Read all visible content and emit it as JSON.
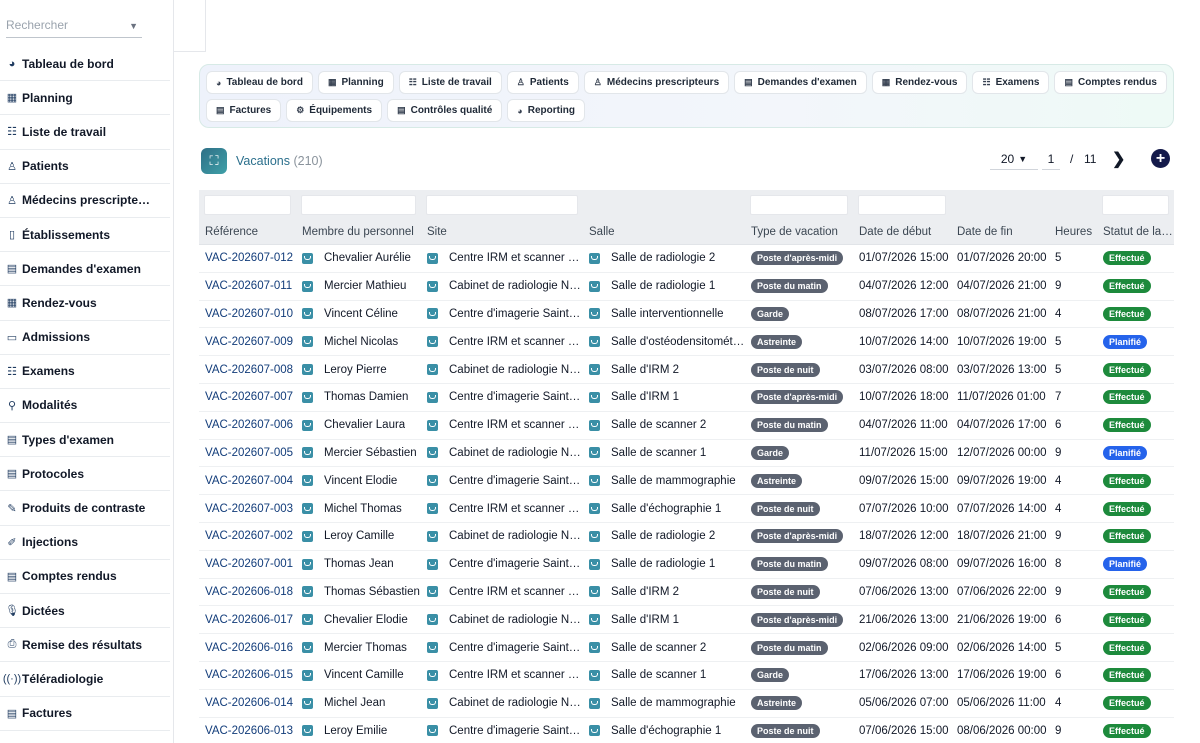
{
  "search": {
    "placeholder": "Rechercher"
  },
  "sidebar": {
    "items": [
      {
        "icon": "dashboard-icon",
        "glyph": "◕",
        "label": "Tableau de bord"
      },
      {
        "icon": "calendar-icon",
        "glyph": "▦",
        "label": "Planning"
      },
      {
        "icon": "worklist-icon",
        "glyph": "☷",
        "label": "Liste de travail"
      },
      {
        "icon": "patients-icon",
        "glyph": "♙",
        "label": "Patients"
      },
      {
        "icon": "doctor-icon",
        "glyph": "♙",
        "label": "Médecins prescripte…"
      },
      {
        "icon": "building-icon",
        "glyph": "▯",
        "label": "Établissements"
      },
      {
        "icon": "request-icon",
        "glyph": "▤",
        "label": "Demandes d'examen"
      },
      {
        "icon": "appointment-icon",
        "glyph": "▦",
        "label": "Rendez-vous"
      },
      {
        "icon": "admission-icon",
        "glyph": "▭",
        "label": "Admissions"
      },
      {
        "icon": "exam-icon",
        "glyph": "☷",
        "label": "Examens"
      },
      {
        "icon": "modality-icon",
        "glyph": "⚲",
        "label": "Modalités"
      },
      {
        "icon": "exam-type-icon",
        "glyph": "▤",
        "label": "Types d'examen"
      },
      {
        "icon": "protocol-icon",
        "glyph": "▤",
        "label": "Protocoles"
      },
      {
        "icon": "contrast-icon",
        "glyph": "✎",
        "label": "Produits de contraste"
      },
      {
        "icon": "syringe-icon",
        "glyph": "✐",
        "label": "Injections"
      },
      {
        "icon": "report-icon",
        "glyph": "▤",
        "label": "Comptes rendus"
      },
      {
        "icon": "microphone-icon",
        "glyph": "🎙",
        "label": "Dictées"
      },
      {
        "icon": "printer-icon",
        "glyph": "⎙",
        "label": "Remise des résultats"
      },
      {
        "icon": "teleradiology-icon",
        "glyph": "((·))",
        "label": "Téléradiologie"
      },
      {
        "icon": "invoice-icon",
        "glyph": "▤",
        "label": "Factures"
      }
    ]
  },
  "quicknav": {
    "rows": [
      [
        {
          "icon": "dashboard-icon",
          "glyph": "◕",
          "label": "Tableau de bord"
        },
        {
          "icon": "calendar-icon",
          "glyph": "▦",
          "label": "Planning"
        },
        {
          "icon": "worklist-icon",
          "glyph": "☷",
          "label": "Liste de travail"
        },
        {
          "icon": "patients-icon",
          "glyph": "♙",
          "label": "Patients"
        },
        {
          "icon": "doctor-icon",
          "glyph": "♙",
          "label": "Médecins prescripteurs"
        },
        {
          "icon": "request-icon",
          "glyph": "▤",
          "label": "Demandes d'examen"
        },
        {
          "icon": "appointment-icon",
          "glyph": "▦",
          "label": "Rendez-vous"
        },
        {
          "icon": "exam-icon",
          "glyph": "☷",
          "label": "Examens"
        },
        {
          "icon": "report-icon",
          "glyph": "▤",
          "label": "Comptes rendus"
        }
      ],
      [
        {
          "icon": "invoice-icon",
          "glyph": "▤",
          "label": "Factures"
        },
        {
          "icon": "equipment-icon",
          "glyph": "⚙",
          "label": "Équipements"
        },
        {
          "icon": "quality-icon",
          "glyph": "▤",
          "label": "Contrôles qualité"
        },
        {
          "icon": "reporting-icon",
          "glyph": "◕",
          "label": "Reporting"
        }
      ]
    ]
  },
  "header": {
    "title": "Vacations",
    "count": "(210)"
  },
  "pager": {
    "per_page": "20",
    "current": "1",
    "separator": "/",
    "total": "11",
    "next": "❯",
    "add": "+"
  },
  "table": {
    "columns": [
      "Référence",
      "Membre du personnel",
      "Site",
      "Salle",
      "Type de vacation",
      "Date de début",
      "Date de fin",
      "Heures",
      "Statut de la …"
    ],
    "rows": [
      {
        "ref": "VAC-202607-012",
        "staff": "Chevalier Aurélie",
        "site": "Centre IRM et scanner …",
        "room": "Salle de radiologie 2",
        "type": "Poste d'après-midi",
        "start": "01/07/2026 15:00",
        "end": "01/07/2026 20:00",
        "hours": "5",
        "status": "Effectué"
      },
      {
        "ref": "VAC-202607-011",
        "staff": "Mercier Mathieu",
        "site": "Cabinet de radiologie N…",
        "room": "Salle de radiologie 1",
        "type": "Poste du matin",
        "start": "04/07/2026 12:00",
        "end": "04/07/2026 21:00",
        "hours": "9",
        "status": "Effectué"
      },
      {
        "ref": "VAC-202607-010",
        "staff": "Vincent Céline",
        "site": "Centre d'imagerie Saint…",
        "room": "Salle interventionnelle",
        "type": "Garde",
        "start": "08/07/2026 17:00",
        "end": "08/07/2026 21:00",
        "hours": "4",
        "status": "Effectué"
      },
      {
        "ref": "VAC-202607-009",
        "staff": "Michel Nicolas",
        "site": "Centre IRM et scanner …",
        "room": "Salle d'ostéodensitomét…",
        "type": "Astreinte",
        "start": "10/07/2026 14:00",
        "end": "10/07/2026 19:00",
        "hours": "5",
        "status": "Planifié"
      },
      {
        "ref": "VAC-202607-008",
        "staff": "Leroy Pierre",
        "site": "Cabinet de radiologie N…",
        "room": "Salle d'IRM 2",
        "type": "Poste de nuit",
        "start": "03/07/2026 08:00",
        "end": "03/07/2026 13:00",
        "hours": "5",
        "status": "Effectué"
      },
      {
        "ref": "VAC-202607-007",
        "staff": "Thomas Damien",
        "site": "Centre d'imagerie Saint…",
        "room": "Salle d'IRM 1",
        "type": "Poste d'après-midi",
        "start": "10/07/2026 18:00",
        "end": "11/07/2026 01:00",
        "hours": "7",
        "status": "Effectué"
      },
      {
        "ref": "VAC-202607-006",
        "staff": "Chevalier Laura",
        "site": "Centre IRM et scanner …",
        "room": "Salle de scanner 2",
        "type": "Poste du matin",
        "start": "04/07/2026 11:00",
        "end": "04/07/2026 17:00",
        "hours": "6",
        "status": "Effectué"
      },
      {
        "ref": "VAC-202607-005",
        "staff": "Mercier Sébastien",
        "site": "Cabinet de radiologie N…",
        "room": "Salle de scanner 1",
        "type": "Garde",
        "start": "11/07/2026 15:00",
        "end": "12/07/2026 00:00",
        "hours": "9",
        "status": "Planifié"
      },
      {
        "ref": "VAC-202607-004",
        "staff": "Vincent Élodie",
        "site": "Centre d'imagerie Saint…",
        "room": "Salle de mammographie",
        "type": "Astreinte",
        "start": "09/07/2026 15:00",
        "end": "09/07/2026 19:00",
        "hours": "4",
        "status": "Effectué"
      },
      {
        "ref": "VAC-202607-003",
        "staff": "Michel Thomas",
        "site": "Centre IRM et scanner …",
        "room": "Salle d'échographie 1",
        "type": "Poste de nuit",
        "start": "07/07/2026 10:00",
        "end": "07/07/2026 14:00",
        "hours": "4",
        "status": "Effectué"
      },
      {
        "ref": "VAC-202607-002",
        "staff": "Leroy Camille",
        "site": "Cabinet de radiologie N…",
        "room": "Salle de radiologie 2",
        "type": "Poste d'après-midi",
        "start": "18/07/2026 12:00",
        "end": "18/07/2026 21:00",
        "hours": "9",
        "status": "Effectué"
      },
      {
        "ref": "VAC-202607-001",
        "staff": "Thomas Jean",
        "site": "Centre d'imagerie Saint…",
        "room": "Salle de radiologie 1",
        "type": "Poste du matin",
        "start": "09/07/2026 08:00",
        "end": "09/07/2026 16:00",
        "hours": "8",
        "status": "Planifié"
      },
      {
        "ref": "VAC-202606-018",
        "staff": "Thomas Sébastien",
        "site": "Centre IRM et scanner …",
        "room": "Salle d'IRM 2",
        "type": "Poste de nuit",
        "start": "07/06/2026 13:00",
        "end": "07/06/2026 22:00",
        "hours": "9",
        "status": "Effectué"
      },
      {
        "ref": "VAC-202606-017",
        "staff": "Chevalier Élodie",
        "site": "Cabinet de radiologie N…",
        "room": "Salle d'IRM 1",
        "type": "Poste d'après-midi",
        "start": "21/06/2026 13:00",
        "end": "21/06/2026 19:00",
        "hours": "6",
        "status": "Effectué"
      },
      {
        "ref": "VAC-202606-016",
        "staff": "Mercier Thomas",
        "site": "Centre d'imagerie Saint…",
        "room": "Salle de scanner 2",
        "type": "Poste du matin",
        "start": "02/06/2026 09:00",
        "end": "02/06/2026 14:00",
        "hours": "5",
        "status": "Effectué"
      },
      {
        "ref": "VAC-202606-015",
        "staff": "Vincent Camille",
        "site": "Centre IRM et scanner …",
        "room": "Salle de scanner 1",
        "type": "Garde",
        "start": "17/06/2026 13:00",
        "end": "17/06/2026 19:00",
        "hours": "6",
        "status": "Effectué"
      },
      {
        "ref": "VAC-202606-014",
        "staff": "Michel Jean",
        "site": "Cabinet de radiologie N…",
        "room": "Salle de mammographie",
        "type": "Astreinte",
        "start": "05/06/2026 07:00",
        "end": "05/06/2026 11:00",
        "hours": "4",
        "status": "Effectué"
      },
      {
        "ref": "VAC-202606-013",
        "staff": "Leroy Émilie",
        "site": "Centre d'imagerie Saint…",
        "room": "Salle d'échographie 1",
        "type": "Poste de nuit",
        "start": "07/06/2026 15:00",
        "end": "08/06/2026 00:00",
        "hours": "9",
        "status": "Effectué"
      }
    ]
  },
  "colors": {
    "done": "#1d8a3c",
    "planned": "#2563eb",
    "accent": "#2b6f8c",
    "add": "#141a4a"
  }
}
